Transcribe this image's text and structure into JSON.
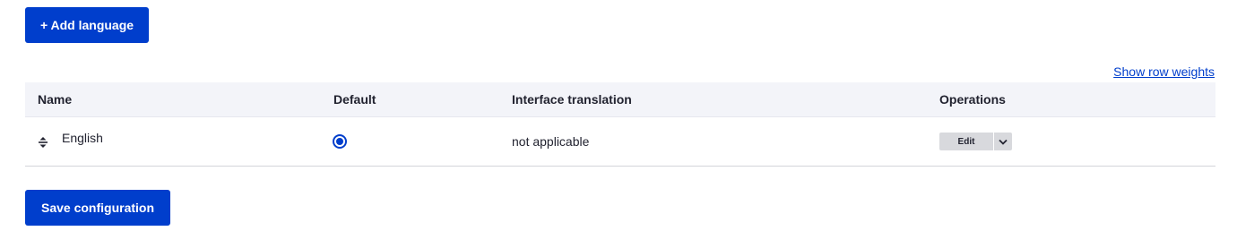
{
  "actions": {
    "add_language_label": "+ Add language",
    "save_label": "Save configuration"
  },
  "table": {
    "show_weights_link": "Show row weights",
    "headers": {
      "name": "Name",
      "default": "Default",
      "interface_translation": "Interface translation",
      "operations": "Operations"
    },
    "rows": [
      {
        "name": "English",
        "default_selected": true,
        "interface_translation": "not applicable",
        "edit_label": "Edit"
      }
    ]
  },
  "colors": {
    "primary": "#003ecc",
    "header_bg": "#f3f4f9",
    "ops_bg": "#d8d9dd"
  },
  "icons": {
    "drag": "drag-handle-icon",
    "dropdown": "chevron-down-icon"
  }
}
